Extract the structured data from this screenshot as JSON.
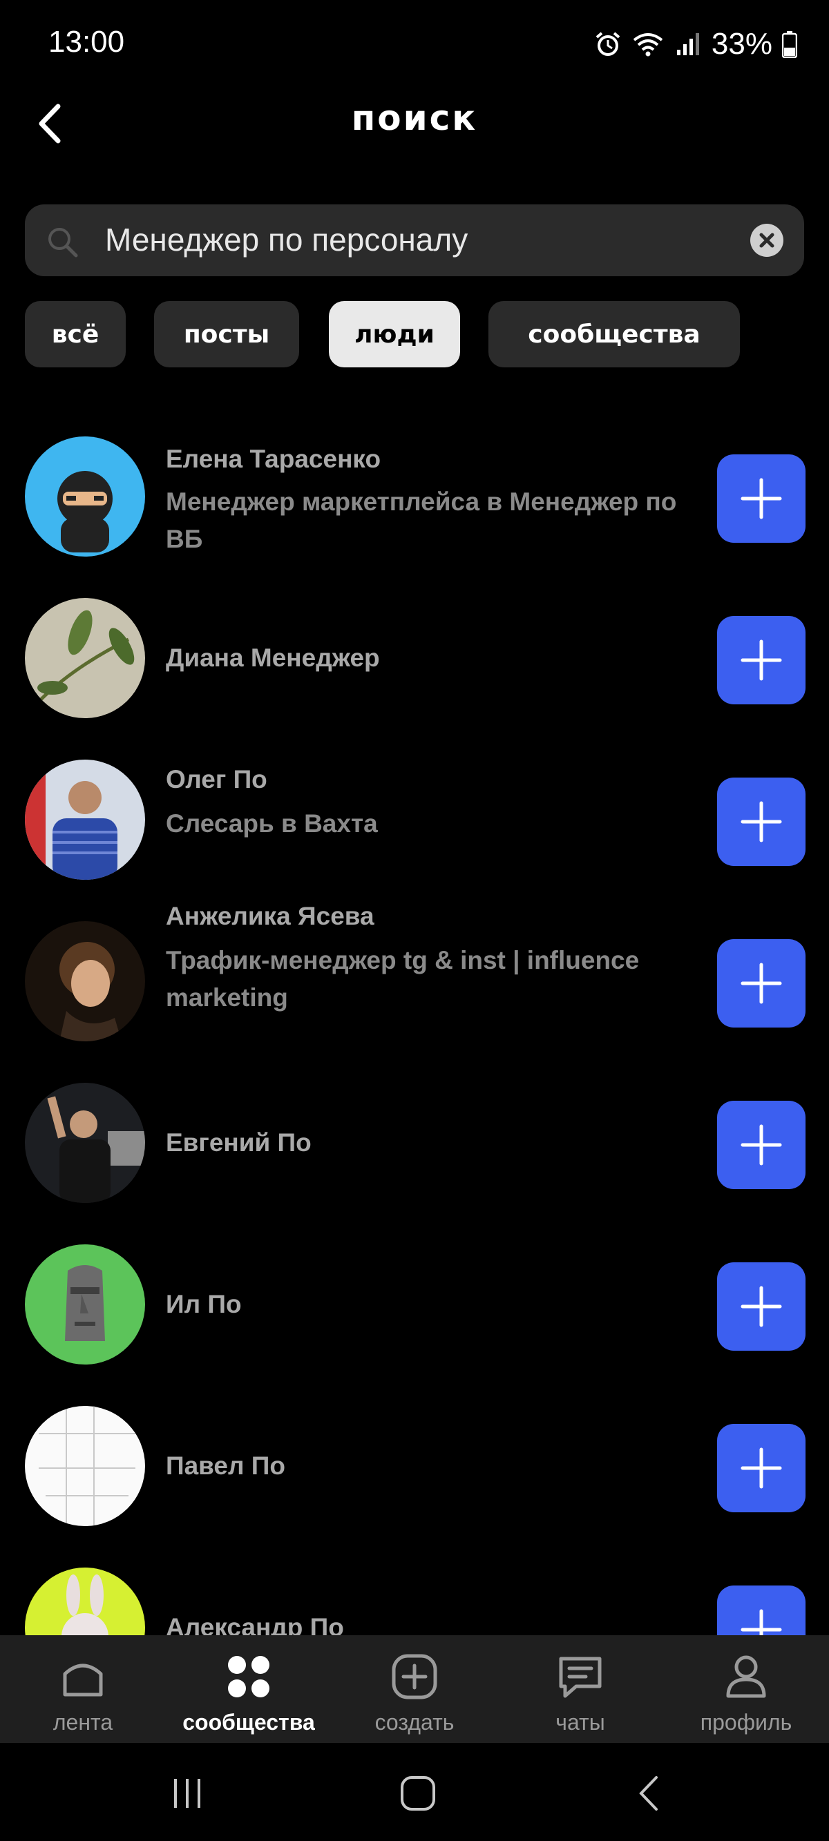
{
  "status": {
    "time": "13:00",
    "battery": "33%"
  },
  "header": {
    "title": "поиск"
  },
  "search": {
    "value": "Менеджер по персоналу"
  },
  "filters": [
    "всё",
    "посты",
    "люди",
    "сообщества"
  ],
  "active_filter": "люди",
  "results": [
    {
      "name": "Елена Тарасенко",
      "subtitle": "Менеджер маркетплейса в Менеджер по ВБ",
      "avatar": "ninja-emoji"
    },
    {
      "name": "Диана Менеджер",
      "subtitle": "",
      "avatar": "plant-photo"
    },
    {
      "name": "Олег По",
      "subtitle": "Слесарь в Вахта",
      "avatar": "man-photo"
    },
    {
      "name": "Анжелика Ясева",
      "subtitle": "Трафик-менеджер tg & inst | influence marketing",
      "avatar": "woman-photo"
    },
    {
      "name": "Евгений По",
      "subtitle": "",
      "avatar": "man-night-photo"
    },
    {
      "name": "Ил По",
      "subtitle": "",
      "avatar": "moai-emoji"
    },
    {
      "name": "Павел По",
      "subtitle": "",
      "avatar": "sketch-image"
    },
    {
      "name": "Александр По",
      "subtitle": "",
      "avatar": "rabbit-image"
    }
  ],
  "nav": [
    {
      "label": "лента",
      "icon": "home-icon"
    },
    {
      "label": "сообщества",
      "icon": "grid-icon"
    },
    {
      "label": "создать",
      "icon": "plus-square-icon"
    },
    {
      "label": "чаты",
      "icon": "chat-icon"
    },
    {
      "label": "профиль",
      "icon": "user-icon"
    }
  ],
  "active_nav": "сообщества",
  "colors": {
    "accent": "#3c5ff0",
    "background": "#000000",
    "surface": "#2b2b2b"
  }
}
